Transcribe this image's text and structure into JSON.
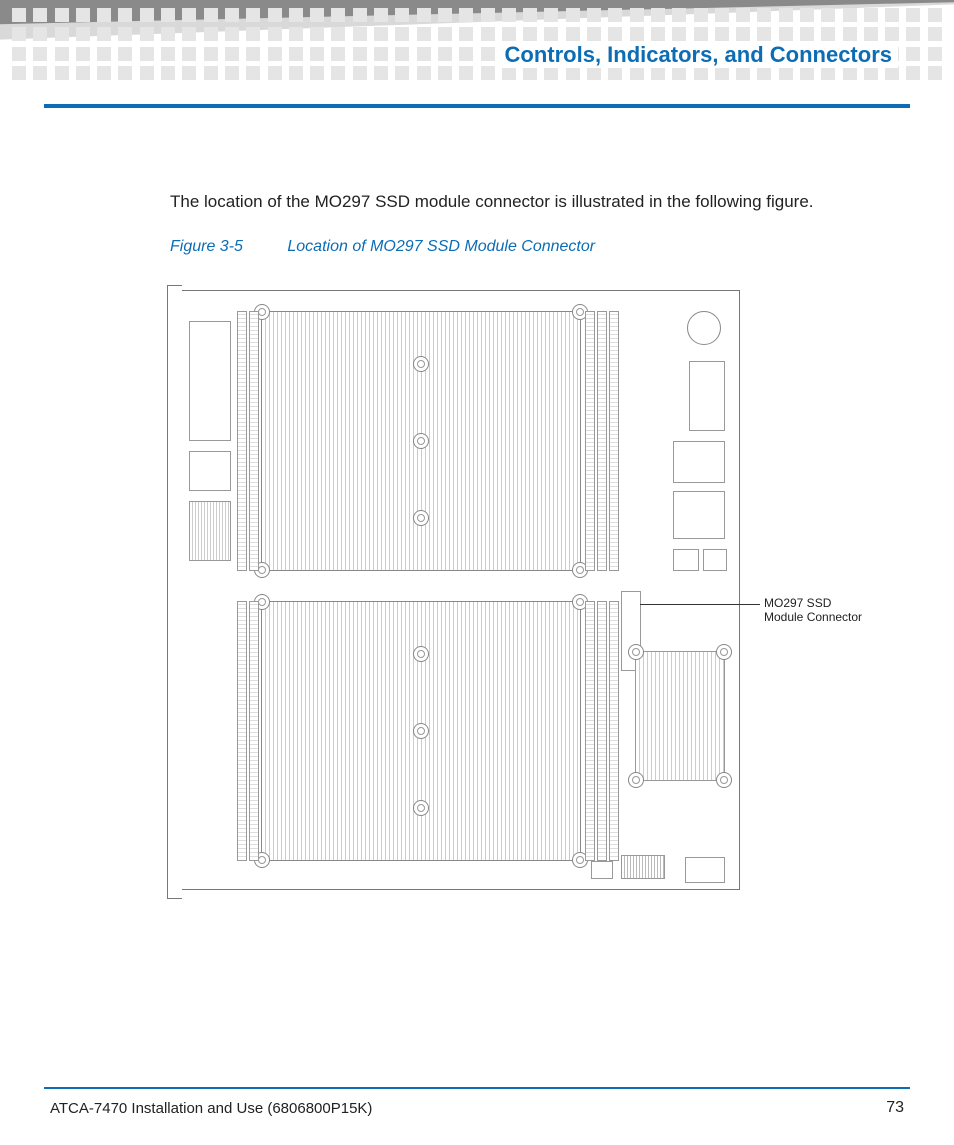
{
  "header": {
    "section_title": "Controls, Indicators, and Connectors"
  },
  "body": {
    "intro_text": "The location of the MO297 SSD module connector is illustrated in the following figure."
  },
  "figure": {
    "number": "Figure 3-5",
    "title": "Location of MO297 SSD Module Connector",
    "callout_line1": "MO297 SSD",
    "callout_line2": "Module Connector"
  },
  "footer": {
    "doc_title": "ATCA-7470 Installation and Use (6806800P15K)",
    "page_number": "73"
  }
}
